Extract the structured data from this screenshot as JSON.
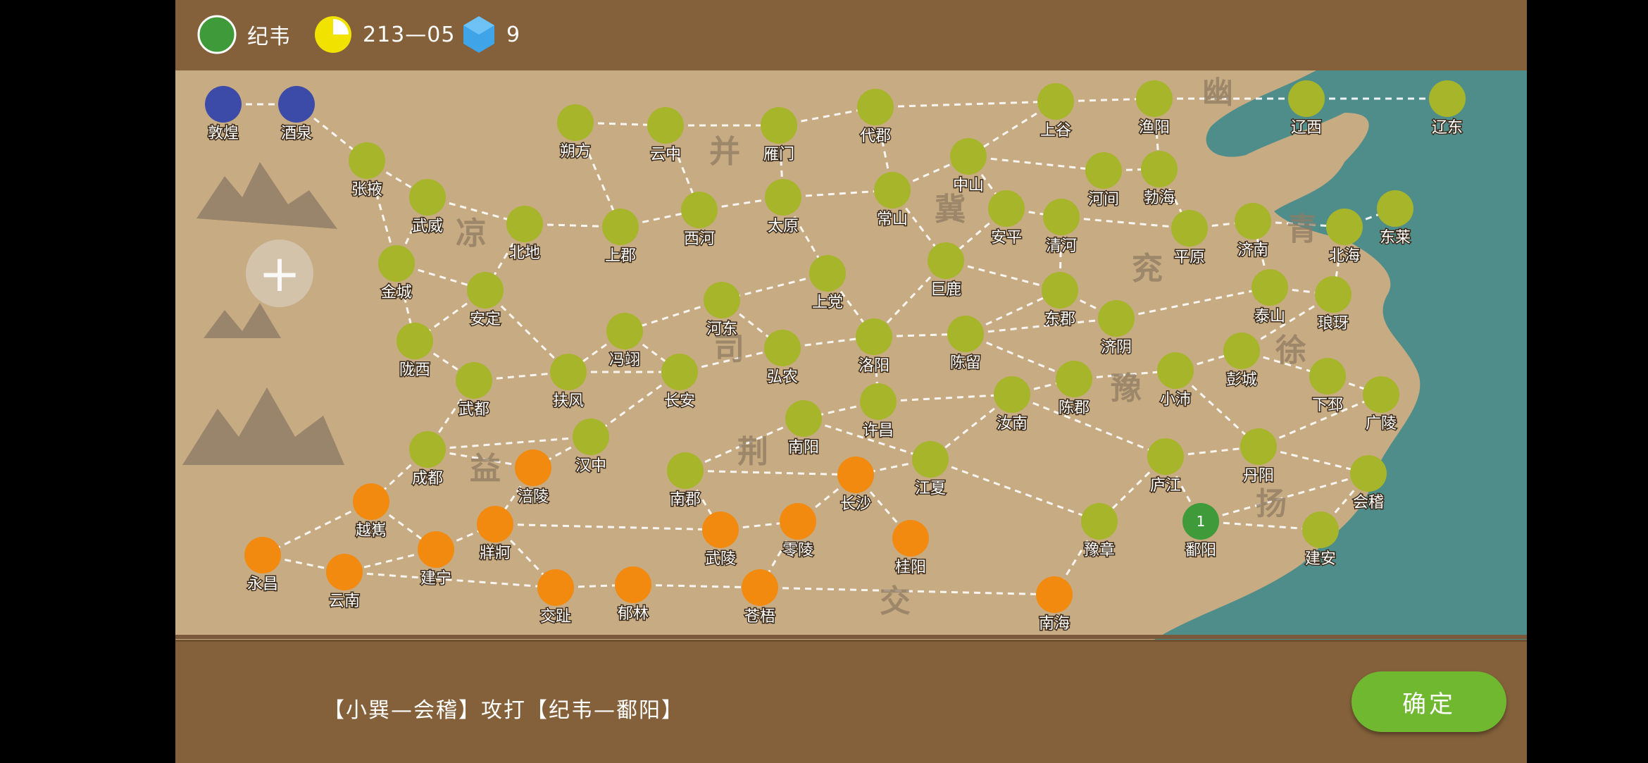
{
  "header": {
    "player_name": "纪韦",
    "player_color": "#3f9a3a",
    "date": "213—05",
    "resource_icon": "hexagon-gem-icon",
    "resource_count": "9"
  },
  "colors": {
    "sea": "#4f8d8b",
    "land": "#c8ad84",
    "player_blue": "#3c4aa8",
    "player_olive": "#a6b52a",
    "player_orange": "#f28a10",
    "player_green": "#3f9a3a"
  },
  "regions": [
    "幽",
    "并",
    "冀",
    "凉",
    "兖",
    "青",
    "司",
    "徐",
    "豫",
    "益",
    "荆",
    "扬",
    "交"
  ],
  "cities": [
    {
      "name": "敦煌",
      "owner": "blue"
    },
    {
      "name": "酒泉",
      "owner": "blue"
    },
    {
      "name": "张掖",
      "owner": "olive"
    },
    {
      "name": "武威",
      "owner": "olive"
    },
    {
      "name": "北地",
      "owner": "olive"
    },
    {
      "name": "金城",
      "owner": "olive"
    },
    {
      "name": "安定",
      "owner": "olive"
    },
    {
      "name": "陇西",
      "owner": "olive"
    },
    {
      "name": "武都",
      "owner": "olive"
    },
    {
      "name": "朔方",
      "owner": "olive"
    },
    {
      "name": "云中",
      "owner": "olive"
    },
    {
      "name": "雁门",
      "owner": "olive"
    },
    {
      "name": "代郡",
      "owner": "olive"
    },
    {
      "name": "上谷",
      "owner": "olive"
    },
    {
      "name": "渔阳",
      "owner": "olive"
    },
    {
      "name": "辽西",
      "owner": "olive"
    },
    {
      "name": "辽东",
      "owner": "olive"
    },
    {
      "name": "上郡",
      "owner": "olive"
    },
    {
      "name": "西河",
      "owner": "olive"
    },
    {
      "name": "太原",
      "owner": "olive"
    },
    {
      "name": "常山",
      "owner": "olive"
    },
    {
      "name": "中山",
      "owner": "olive"
    },
    {
      "name": "安平",
      "owner": "olive"
    },
    {
      "name": "河间",
      "owner": "olive"
    },
    {
      "name": "勃海",
      "owner": "olive"
    },
    {
      "name": "清河",
      "owner": "olive"
    },
    {
      "name": "平原",
      "owner": "olive"
    },
    {
      "name": "济南",
      "owner": "olive"
    },
    {
      "name": "北海",
      "owner": "olive"
    },
    {
      "name": "东莱",
      "owner": "olive"
    },
    {
      "name": "上党",
      "owner": "olive"
    },
    {
      "name": "巨鹿",
      "owner": "olive"
    },
    {
      "name": "东郡",
      "owner": "olive"
    },
    {
      "name": "济阴",
      "owner": "olive"
    },
    {
      "name": "泰山",
      "owner": "olive"
    },
    {
      "name": "琅玡",
      "owner": "olive"
    },
    {
      "name": "河东",
      "owner": "olive"
    },
    {
      "name": "冯翊",
      "owner": "olive"
    },
    {
      "name": "弘农",
      "owner": "olive"
    },
    {
      "name": "洛阳",
      "owner": "olive"
    },
    {
      "name": "陈留",
      "owner": "olive"
    },
    {
      "name": "彭城",
      "owner": "olive"
    },
    {
      "name": "扶风",
      "owner": "olive"
    },
    {
      "name": "长安",
      "owner": "olive"
    },
    {
      "name": "陈郡",
      "owner": "olive"
    },
    {
      "name": "小沛",
      "owner": "olive"
    },
    {
      "name": "下邳",
      "owner": "olive"
    },
    {
      "name": "广陵",
      "owner": "olive"
    },
    {
      "name": "许昌",
      "owner": "olive"
    },
    {
      "name": "汝南",
      "owner": "olive"
    },
    {
      "name": "南阳",
      "owner": "olive"
    },
    {
      "name": "汉中",
      "owner": "olive"
    },
    {
      "name": "成都",
      "owner": "olive"
    },
    {
      "name": "南郡",
      "owner": "olive"
    },
    {
      "name": "江夏",
      "owner": "olive"
    },
    {
      "name": "庐江",
      "owner": "olive"
    },
    {
      "name": "丹阳",
      "owner": "olive"
    },
    {
      "name": "会稽",
      "owner": "olive"
    },
    {
      "name": "豫章",
      "owner": "olive"
    },
    {
      "name": "建安",
      "owner": "olive"
    },
    {
      "name": "鄱阳",
      "owner": "green",
      "badge": "1"
    },
    {
      "name": "涪陵",
      "owner": "orange"
    },
    {
      "name": "越嶲",
      "owner": "orange"
    },
    {
      "name": "牂牁",
      "owner": "orange"
    },
    {
      "name": "永昌",
      "owner": "orange"
    },
    {
      "name": "建宁",
      "owner": "orange"
    },
    {
      "name": "云南",
      "owner": "orange"
    },
    {
      "name": "长沙",
      "owner": "orange"
    },
    {
      "name": "武陵",
      "owner": "orange"
    },
    {
      "name": "零陵",
      "owner": "orange"
    },
    {
      "name": "桂阳",
      "owner": "orange"
    },
    {
      "name": "交趾",
      "owner": "orange"
    },
    {
      "name": "郁林",
      "owner": "orange"
    },
    {
      "name": "苍梧",
      "owner": "orange"
    },
    {
      "name": "南海",
      "owner": "orange"
    }
  ],
  "roads": [
    [
      "敦煌",
      "酒泉"
    ],
    [
      "酒泉",
      "张掖"
    ],
    [
      "张掖",
      "武威"
    ],
    [
      "张掖",
      "金城"
    ],
    [
      "武威",
      "北地"
    ],
    [
      "武威",
      "金城"
    ],
    [
      "北地",
      "上郡"
    ],
    [
      "北地",
      "安定"
    ],
    [
      "金城",
      "安定"
    ],
    [
      "金城",
      "陇西"
    ],
    [
      "安定",
      "陇西"
    ],
    [
      "安定",
      "扶风"
    ],
    [
      "陇西",
      "武都"
    ],
    [
      "武都",
      "扶风"
    ],
    [
      "武都",
      "成都"
    ],
    [
      "朔方",
      "云中"
    ],
    [
      "朔方",
      "上郡"
    ],
    [
      "云中",
      "雁门"
    ],
    [
      "云中",
      "西河"
    ],
    [
      "雁门",
      "代郡"
    ],
    [
      "雁门",
      "太原"
    ],
    [
      "代郡",
      "上谷"
    ],
    [
      "代郡",
      "常山"
    ],
    [
      "上谷",
      "渔阳"
    ],
    [
      "上谷",
      "中山"
    ],
    [
      "渔阳",
      "辽西"
    ],
    [
      "辽西",
      "辽东"
    ],
    [
      "渔阳",
      "勃海"
    ],
    [
      "上郡",
      "西河"
    ],
    [
      "西河",
      "太原"
    ],
    [
      "太原",
      "常山"
    ],
    [
      "太原",
      "上党"
    ],
    [
      "常山",
      "中山"
    ],
    [
      "常山",
      "巨鹿"
    ],
    [
      "中山",
      "安平"
    ],
    [
      "中山",
      "河间"
    ],
    [
      "河间",
      "勃海"
    ],
    [
      "安平",
      "清河"
    ],
    [
      "勃海",
      "平原"
    ],
    [
      "清河",
      "平原"
    ],
    [
      "平原",
      "济南"
    ],
    [
      "济南",
      "北海"
    ],
    [
      "北海",
      "东莱"
    ],
    [
      "北海",
      "琅玡"
    ],
    [
      "安平",
      "巨鹿"
    ],
    [
      "巨鹿",
      "东郡"
    ],
    [
      "清河",
      "东郡"
    ],
    [
      "东郡",
      "济阴"
    ],
    [
      "济阴",
      "泰山"
    ],
    [
      "泰山",
      "济南"
    ],
    [
      "泰山",
      "琅玡"
    ],
    [
      "上党",
      "河东"
    ],
    [
      "上党",
      "洛阳"
    ],
    [
      "河东",
      "冯翊"
    ],
    [
      "河东",
      "弘农"
    ],
    [
      "冯翊",
      "扶风"
    ],
    [
      "冯翊",
      "长安"
    ],
    [
      "扶风",
      "长安"
    ],
    [
      "长安",
      "弘农"
    ],
    [
      "弘农",
      "洛阳"
    ],
    [
      "洛阳",
      "陈留"
    ],
    [
      "洛阳",
      "许昌"
    ],
    [
      "巨鹿",
      "洛阳"
    ],
    [
      "陈留",
      "东郡"
    ],
    [
      "陈留",
      "济阴"
    ],
    [
      "陈留",
      "陈郡"
    ],
    [
      "许昌",
      "汝南"
    ],
    [
      "许昌",
      "南阳"
    ],
    [
      "汝南",
      "陈郡"
    ],
    [
      "陈郡",
      "小沛"
    ],
    [
      "小沛",
      "彭城"
    ],
    [
      "彭城",
      "琅玡"
    ],
    [
      "彭城",
      "下邳"
    ],
    [
      "下邳",
      "广陵"
    ],
    [
      "汝南",
      "江夏"
    ],
    [
      "汝南",
      "庐江"
    ],
    [
      "小沛",
      "丹阳"
    ],
    [
      "丹阳",
      "广陵"
    ],
    [
      "丹阳",
      "会稽"
    ],
    [
      "庐江",
      "丹阳"
    ],
    [
      "庐江",
      "鄱阳"
    ],
    [
      "庐江",
      "豫章"
    ],
    [
      "鄱阳",
      "建安"
    ],
    [
      "会稽",
      "建安"
    ],
    [
      "鄱阳",
      "会稽"
    ],
    [
      "豫章",
      "南海"
    ],
    [
      "南阳",
      "南郡"
    ],
    [
      "南阳",
      "江夏"
    ],
    [
      "长安",
      "汉中"
    ],
    [
      "汉中",
      "成都"
    ],
    [
      "汉中",
      "涪陵"
    ],
    [
      "成都",
      "越嶲"
    ],
    [
      "成都",
      "涪陵"
    ],
    [
      "涪陵",
      "牂牁"
    ],
    [
      "越嶲",
      "永昌"
    ],
    [
      "越嶲",
      "建宁"
    ],
    [
      "永昌",
      "云南"
    ],
    [
      "建宁",
      "云南"
    ],
    [
      "建宁",
      "牂牁"
    ],
    [
      "牂牁",
      "交趾"
    ],
    [
      "云南",
      "交趾"
    ],
    [
      "交趾",
      "郁林"
    ],
    [
      "郁林",
      "苍梧"
    ],
    [
      "苍梧",
      "南海"
    ],
    [
      "南郡",
      "武陵"
    ],
    [
      "南郡",
      "长沙"
    ],
    [
      "江夏",
      "长沙"
    ],
    [
      "长沙",
      "零陵"
    ],
    [
      "长沙",
      "桂阳"
    ],
    [
      "武陵",
      "零陵"
    ],
    [
      "零陵",
      "苍梧"
    ],
    [
      "江夏",
      "豫章"
    ],
    [
      "牂牁",
      "武陵"
    ]
  ],
  "battle": {
    "message": "【小巽—会稽】攻打【纪韦—鄱阳】"
  },
  "footer": {
    "confirm_label": "确定"
  },
  "zoom": {
    "label": "+"
  }
}
